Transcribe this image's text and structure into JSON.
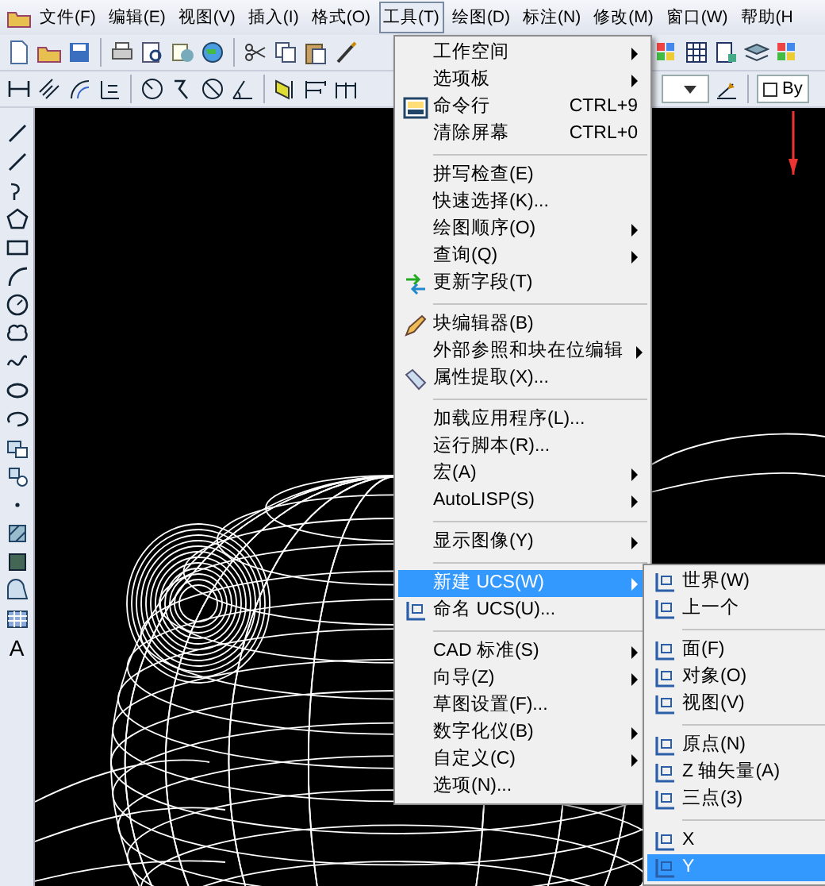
{
  "menubar": [
    {
      "label": "文件(F)",
      "selected": false
    },
    {
      "label": "编辑(E)",
      "selected": false
    },
    {
      "label": "视图(V)",
      "selected": false
    },
    {
      "label": "插入(I)",
      "selected": false
    },
    {
      "label": "格式(O)",
      "selected": false
    },
    {
      "label": "工具(T)",
      "selected": true
    },
    {
      "label": "绘图(D)",
      "selected": false
    },
    {
      "label": "标注(N)",
      "selected": false
    },
    {
      "label": "修改(M)",
      "selected": false
    },
    {
      "label": "窗口(W)",
      "selected": false
    },
    {
      "label": "帮助(H",
      "selected": false
    }
  ],
  "properties_toolbar": {
    "color_value": "By"
  },
  "draw_toolbar": {
    "text_tool": "A"
  },
  "tools_menu": {
    "items": [
      {
        "kind": "item",
        "label": "工作空间",
        "submenu": true,
        "has_icon": false,
        "selected": false
      },
      {
        "kind": "item",
        "label": "选项板",
        "submenu": true,
        "has_icon": false,
        "selected": false
      },
      {
        "kind": "item",
        "label": "命令行",
        "shortcut": "CTRL+9",
        "submenu": false,
        "has_icon": true,
        "selected": false
      },
      {
        "kind": "item",
        "label": "清除屏幕",
        "shortcut": "CTRL+0",
        "submenu": false,
        "has_icon": false,
        "selected": false
      },
      {
        "kind": "separator"
      },
      {
        "kind": "item",
        "label": "拼写检查(E)",
        "submenu": false,
        "has_icon": false,
        "selected": false
      },
      {
        "kind": "item",
        "label": "快速选择(K)...",
        "submenu": false,
        "has_icon": false,
        "selected": false
      },
      {
        "kind": "item",
        "label": "绘图顺序(O)",
        "submenu": true,
        "has_icon": false,
        "selected": false
      },
      {
        "kind": "item",
        "label": "查询(Q)",
        "submenu": true,
        "has_icon": false,
        "selected": false
      },
      {
        "kind": "item",
        "label": "更新字段(T)",
        "submenu": false,
        "has_icon": true,
        "selected": false
      },
      {
        "kind": "separator"
      },
      {
        "kind": "item",
        "label": "块编辑器(B)",
        "submenu": false,
        "has_icon": true,
        "selected": false
      },
      {
        "kind": "item",
        "label": "外部参照和块在位编辑",
        "submenu": true,
        "has_icon": false,
        "selected": false
      },
      {
        "kind": "item",
        "label": "属性提取(X)...",
        "submenu": false,
        "has_icon": true,
        "selected": false
      },
      {
        "kind": "separator"
      },
      {
        "kind": "item",
        "label": "加载应用程序(L)...",
        "submenu": false,
        "has_icon": false,
        "selected": false
      },
      {
        "kind": "item",
        "label": "运行脚本(R)...",
        "submenu": false,
        "has_icon": false,
        "selected": false
      },
      {
        "kind": "item",
        "label": "宏(A)",
        "submenu": true,
        "has_icon": false,
        "selected": false
      },
      {
        "kind": "item",
        "label": "AutoLISP(S)",
        "submenu": true,
        "has_icon": false,
        "selected": false
      },
      {
        "kind": "separator"
      },
      {
        "kind": "item",
        "label": "显示图像(Y)",
        "submenu": true,
        "has_icon": false,
        "selected": false
      },
      {
        "kind": "separator"
      },
      {
        "kind": "item",
        "label": "新建 UCS(W)",
        "submenu": true,
        "has_icon": false,
        "selected": true
      },
      {
        "kind": "item",
        "label": "命名 UCS(U)...",
        "submenu": false,
        "has_icon": true,
        "selected": false
      },
      {
        "kind": "separator"
      },
      {
        "kind": "item",
        "label": "CAD 标准(S)",
        "submenu": true,
        "has_icon": false,
        "selected": false
      },
      {
        "kind": "item",
        "label": "向导(Z)",
        "submenu": true,
        "has_icon": false,
        "selected": false
      },
      {
        "kind": "item",
        "label": "草图设置(F)...",
        "submenu": false,
        "has_icon": false,
        "selected": false
      },
      {
        "kind": "item",
        "label": "数字化仪(B)",
        "submenu": true,
        "has_icon": false,
        "selected": false
      },
      {
        "kind": "item",
        "label": "自定义(C)",
        "submenu": true,
        "has_icon": false,
        "selected": false
      },
      {
        "kind": "item",
        "label": "选项(N)...",
        "submenu": false,
        "has_icon": false,
        "selected": false
      }
    ]
  },
  "ucs_submenu": {
    "items": [
      {
        "kind": "item",
        "label": "世界(W)",
        "has_icon": true,
        "selected": false
      },
      {
        "kind": "item",
        "label": "上一个",
        "has_icon": true,
        "selected": false
      },
      {
        "kind": "separator"
      },
      {
        "kind": "item",
        "label": "面(F)",
        "has_icon": true,
        "selected": false
      },
      {
        "kind": "item",
        "label": "对象(O)",
        "has_icon": true,
        "selected": false
      },
      {
        "kind": "item",
        "label": "视图(V)",
        "has_icon": true,
        "selected": false
      },
      {
        "kind": "separator"
      },
      {
        "kind": "item",
        "label": "原点(N)",
        "has_icon": true,
        "selected": false
      },
      {
        "kind": "item",
        "label": "Z 轴矢量(A)",
        "has_icon": true,
        "selected": false
      },
      {
        "kind": "item",
        "label": "三点(3)",
        "has_icon": true,
        "selected": false
      },
      {
        "kind": "separator"
      },
      {
        "kind": "item",
        "label": "X",
        "has_icon": true,
        "selected": false
      },
      {
        "kind": "item",
        "label": "Y",
        "has_icon": true,
        "selected": true
      }
    ]
  }
}
